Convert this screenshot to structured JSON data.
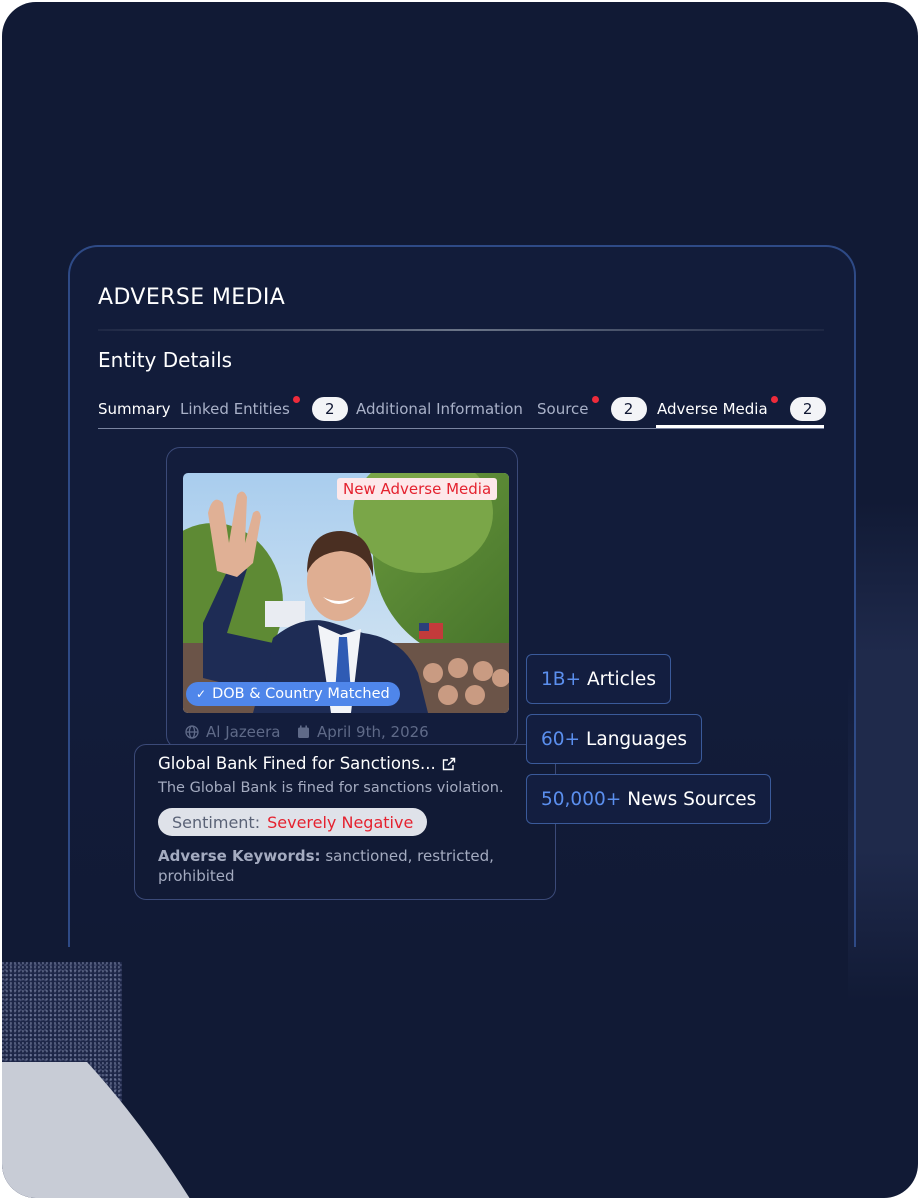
{
  "panel": {
    "title": "ADVERSE MEDIA",
    "entity_title": "Entity Details"
  },
  "tabs": [
    {
      "label": "Summary",
      "has_alert": false,
      "count": null,
      "active": false
    },
    {
      "label": "Linked Entities",
      "has_alert": true,
      "count": "2",
      "active": false
    },
    {
      "label": "Additional Information",
      "has_alert": false,
      "count": null,
      "active": false
    },
    {
      "label": "Source",
      "has_alert": true,
      "count": "2",
      "active": false
    },
    {
      "label": "Adverse Media",
      "has_alert": true,
      "count": "2",
      "active": true
    }
  ],
  "media_card": {
    "new_badge": "New Adverse Media",
    "match_badge": "DOB & Country Matched",
    "source": "Al Jazeera",
    "date": "April 9th, 2026"
  },
  "article": {
    "title": "Global Bank Fined for Sanctions...",
    "description": "The Global Bank is fined for sanctions violation.",
    "sentiment_label": "Sentiment:",
    "sentiment_value": "Severely Negative",
    "keywords_label": "Adverse Keywords:",
    "keywords": "sanctioned, restricted, prohibited"
  },
  "stats": [
    {
      "number": "1B+",
      "label": "Articles"
    },
    {
      "number": "60+",
      "label": "Languages"
    },
    {
      "number": "50,000+",
      "label": "News Sources"
    }
  ],
  "colors": {
    "background": "#111a35",
    "accent_blue": "#5b8fee",
    "alert_red": "#ee2b3b",
    "negative_red": "#e5222f",
    "match_badge": "#4f86ea"
  },
  "icons": {
    "source": "globe-icon",
    "date": "calendar-icon",
    "external_link": "external-link-icon",
    "check": "check-icon"
  }
}
